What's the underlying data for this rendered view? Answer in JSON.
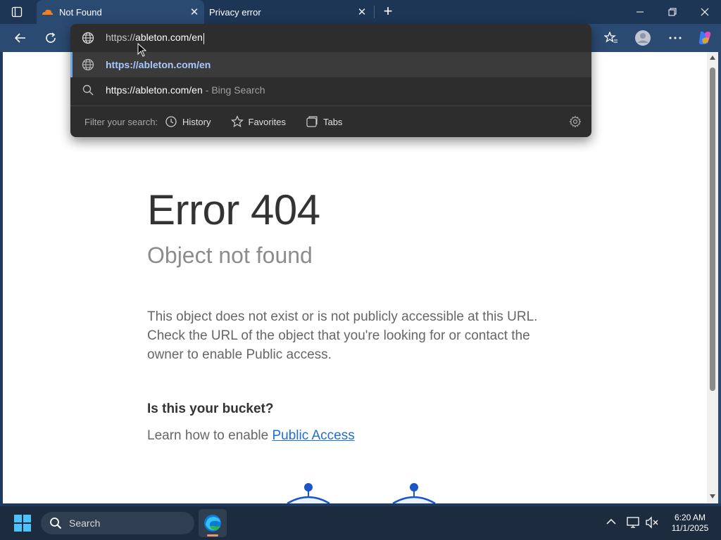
{
  "browser": {
    "tabs": [
      {
        "title": "Not Found",
        "active": true,
        "favicon": "cloudflare-icon"
      },
      {
        "title": "Privacy error",
        "active": false
      }
    ],
    "new_tab_label": "+",
    "window_controls": [
      "minimize-icon",
      "restore-icon",
      "close-icon"
    ]
  },
  "omnibox": {
    "input_prefix": "https://",
    "input_host": "ableton.com/en",
    "suggestions": [
      {
        "url": "https://ableton.com/en",
        "icon": "globe-icon",
        "selected": true
      },
      {
        "url": "https://ableton.com/en",
        "hint": "- Bing Search",
        "icon": "search-icon"
      }
    ],
    "filter_label": "Filter your search:",
    "filters": [
      "History",
      "Favorites",
      "Tabs"
    ]
  },
  "page": {
    "title": "Error 404",
    "subtitle": "Object not found",
    "body_line1": "This object does not exist or is not publicly accessible at this URL.",
    "body_line2": "Check the URL of the object that you're looking for or contact the",
    "body_line3": "owner to enable Public access.",
    "bucket_question": "Is this your bucket?",
    "learn_prefix": "Learn how to enable ",
    "learn_link": "Public Access"
  },
  "taskbar": {
    "search_placeholder": "Search",
    "time": "6:20 AM",
    "date": "11/1/2025"
  },
  "colors": {
    "tab_bar": "#1e3656",
    "toolbar": "#2b4a72",
    "link": "#1f6fce",
    "omnibox_bg": "#2d2d2d"
  }
}
